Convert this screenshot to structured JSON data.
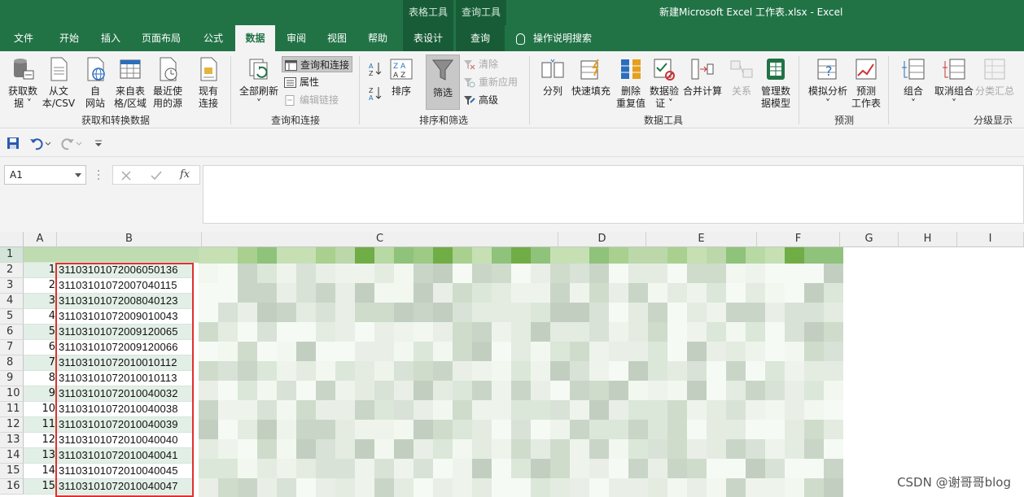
{
  "window": {
    "title": "新建Microsoft Excel 工作表.xlsx  -  Excel",
    "context_tabs": [
      "表格工具",
      "查询工具"
    ]
  },
  "tabs": [
    "文件",
    "开始",
    "插入",
    "页面布局",
    "公式",
    "数据",
    "审阅",
    "视图",
    "帮助",
    "表设计",
    "查询"
  ],
  "active_tab": "数据",
  "tell_me": "操作说明搜索",
  "ribbon": {
    "groups": [
      {
        "label": "获取和转换数据",
        "buttons": [
          "获取数\n据 ˅",
          "从文\n本/CSV",
          "自\n网站",
          "来自表\n格/区域",
          "最近使\n用的源",
          "现有\n连接"
        ]
      },
      {
        "label": "查询和连接",
        "big": "全部刷新\n˅",
        "small": [
          "查询和连接",
          "属性",
          "编辑链接"
        ]
      },
      {
        "label": "排序和筛选",
        "big": [
          "排序",
          "筛选"
        ],
        "small": [
          "清除",
          "重新应用",
          "高级"
        ]
      },
      {
        "label": "数据工具",
        "buttons": [
          "分列",
          "快速填充",
          "删除\n重复值",
          "数据验\n证 ˅",
          "合并计算",
          "关系",
          "管理数\n据模型"
        ]
      },
      {
        "label": "预测",
        "buttons": [
          "模拟分析\n˅",
          "预测\n工作表"
        ]
      },
      {
        "label": "分级显示",
        "buttons": [
          "组合\n˅",
          "取消组合\n˅",
          "分类汇总"
        ]
      }
    ]
  },
  "formula_bar": {
    "name_box": "A1",
    "fx": "fx",
    "value": ""
  },
  "sheet": {
    "columns": [
      "A",
      "B",
      "C",
      "D",
      "E",
      "F",
      "G",
      "H",
      "I"
    ],
    "row_numbers": [
      1,
      2,
      3,
      4,
      5,
      6,
      7,
      8,
      9,
      10,
      11,
      12,
      13,
      14,
      15,
      16
    ],
    "rows": [
      {
        "a": "",
        "b": ""
      },
      {
        "a": "1",
        "b": "31103101072006050136"
      },
      {
        "a": "2",
        "b": "31103101072007040115"
      },
      {
        "a": "3",
        "b": "31103101072008040123"
      },
      {
        "a": "4",
        "b": "31103101072009010043"
      },
      {
        "a": "5",
        "b": "31103101072009120065"
      },
      {
        "a": "6",
        "b": "31103101072009120066"
      },
      {
        "a": "7",
        "b": "31103101072010010112"
      },
      {
        "a": "8",
        "b": "31103101072010010113"
      },
      {
        "a": "9",
        "b": "31103101072010040032"
      },
      {
        "a": "10",
        "b": "31103101072010040038"
      },
      {
        "a": "11",
        "b": "31103101072010040039"
      },
      {
        "a": "12",
        "b": "31103101072010040040"
      },
      {
        "a": "13",
        "b": "31103101072010040041"
      },
      {
        "a": "14",
        "b": "31103101072010040045"
      },
      {
        "a": "15",
        "b": "31103101072010040047"
      }
    ]
  },
  "watermark": "CSDN @谢哥哥blog",
  "colors": {
    "excel_green": "#217346",
    "context_green": "#185c37",
    "highlight_red": "#e03030",
    "row_band": "#e2efe6"
  }
}
